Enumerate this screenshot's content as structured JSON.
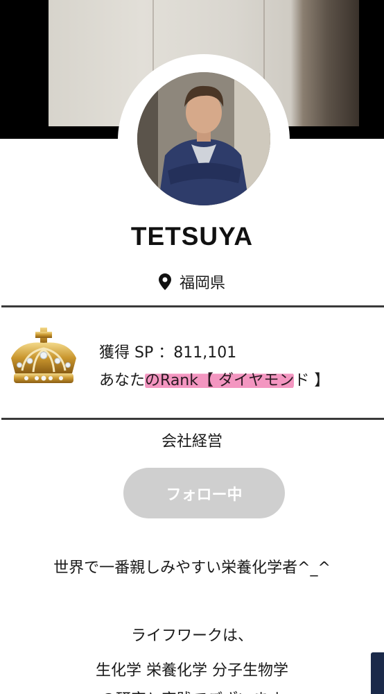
{
  "profile": {
    "name": "TETSUYA",
    "location": "福岡県",
    "sp_line": "獲得 SP ：811,101",
    "rank_prefix": "あなた",
    "rank_highlight": "のRank【 ダイヤモン",
    "rank_suffix": "ド 】",
    "occupation": "会社経営"
  },
  "actions": {
    "follow_label": "フォロー中"
  },
  "bio": {
    "line1": "世界で一番親しみやすい栄養化学者^_^",
    "line2": "ライフワークは、",
    "line3": "生化学 栄養化学 分子生物学",
    "line4": "の研究と実践でございます"
  },
  "icons": {
    "location": "map-pin-icon",
    "rank_badge": "crown-icon"
  },
  "colors": {
    "highlight": "#f078af",
    "button_disabled": "#cfcfcf",
    "divider": "#3a3a3a",
    "scroll_tab": "#1b2a4a"
  }
}
